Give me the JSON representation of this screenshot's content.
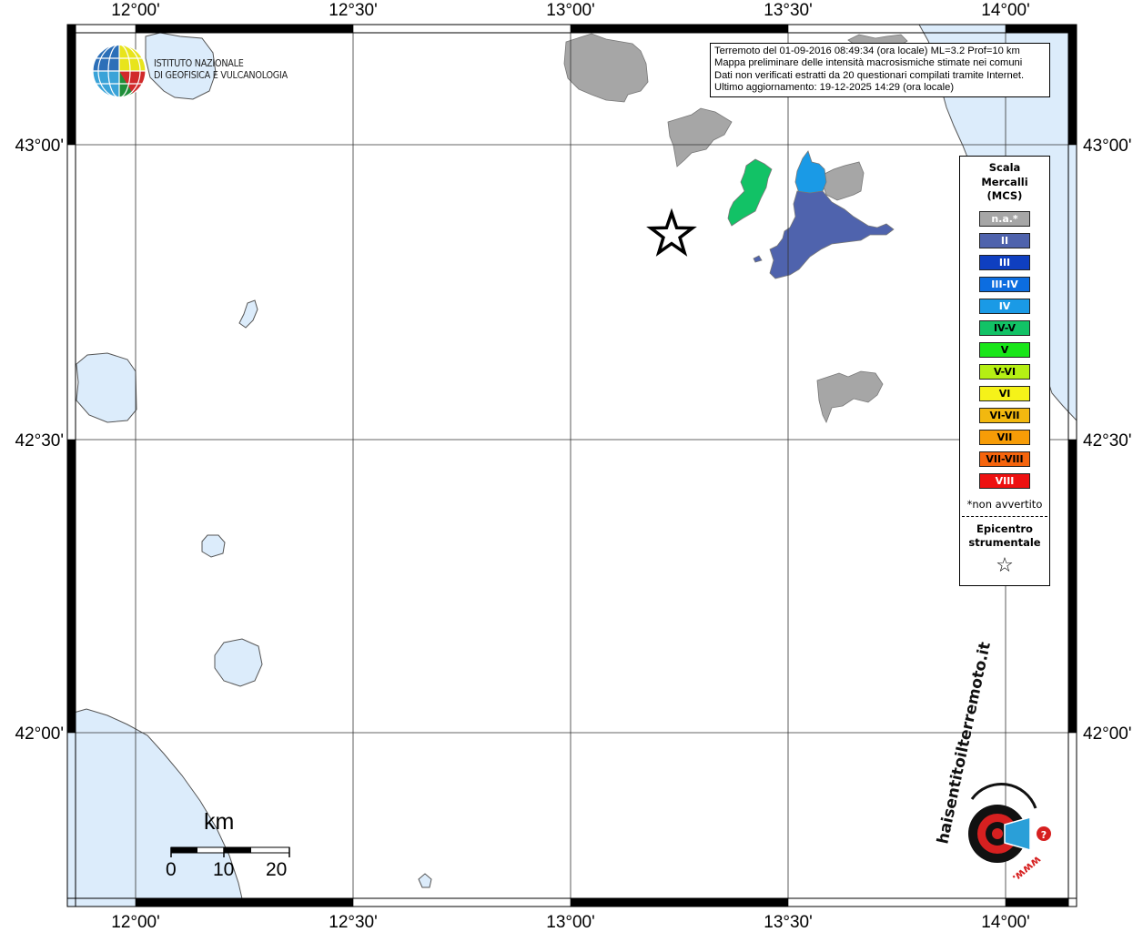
{
  "info": {
    "line1": "Terremoto del 01-09-2016 08:49:34 (ora locale) ML=3.2 Prof=10 km",
    "line2": "Mappa preliminare delle intensità macrosismiche stimate nei comuni",
    "line3": "Dati non verificati estratti da 20 questionari compilati tramite Internet.",
    "line4": "Ultimo aggiornamento: 19-12-2025 14:29 (ora locale)"
  },
  "logo": {
    "line1": "ISTITUTO NAZIONALE",
    "line2": "DI GEOFISICA E VULCANOLOGIA"
  },
  "axes": {
    "lon_labels": [
      "12°00'",
      "12°30'",
      "13°00'",
      "13°30'",
      "14°00'"
    ],
    "lat_labels": [
      "43°00'",
      "42°30'",
      "42°00'"
    ]
  },
  "legend": {
    "title_line1": "Scala",
    "title_line2": "Mercalli",
    "title_line3": "(MCS)",
    "classes": [
      {
        "label": "n.a.*",
        "color": "#a6a6a6",
        "text_color": "#ffffff"
      },
      {
        "label": "II",
        "color": "#4f63ad",
        "text_color": "#ffffff"
      },
      {
        "label": "III",
        "color": "#0f3fc0",
        "text_color": "#ffffff"
      },
      {
        "label": "III-IV",
        "color": "#0c6de0",
        "text_color": "#ffffff"
      },
      {
        "label": "IV",
        "color": "#1a9ae6",
        "text_color": "#ffffff"
      },
      {
        "label": "IV-V",
        "color": "#12c266",
        "text_color": "#000000"
      },
      {
        "label": "V",
        "color": "#19e619",
        "text_color": "#000000"
      },
      {
        "label": "V-VI",
        "color": "#b5ef14",
        "text_color": "#000000"
      },
      {
        "label": "VI",
        "color": "#f5f219",
        "text_color": "#000000"
      },
      {
        "label": "VI-VII",
        "color": "#f2b80f",
        "text_color": "#000000"
      },
      {
        "label": "VII",
        "color": "#f79c07",
        "text_color": "#000000"
      },
      {
        "label": "VII-VIII",
        "color": "#f5640d",
        "text_color": "#000000"
      },
      {
        "label": "VIII",
        "color": "#ee1111",
        "text_color": "#ffffff"
      }
    ],
    "na_note": "*non avvertito",
    "epicenter_line1": "Epicentro",
    "epicenter_line2": "strumentale"
  },
  "scale_bar": {
    "unit": "km",
    "labels": [
      "0",
      "10",
      "20"
    ]
  },
  "watermark": {
    "text_main": "haisentitoilterremoto.it",
    "text_www": "www."
  }
}
